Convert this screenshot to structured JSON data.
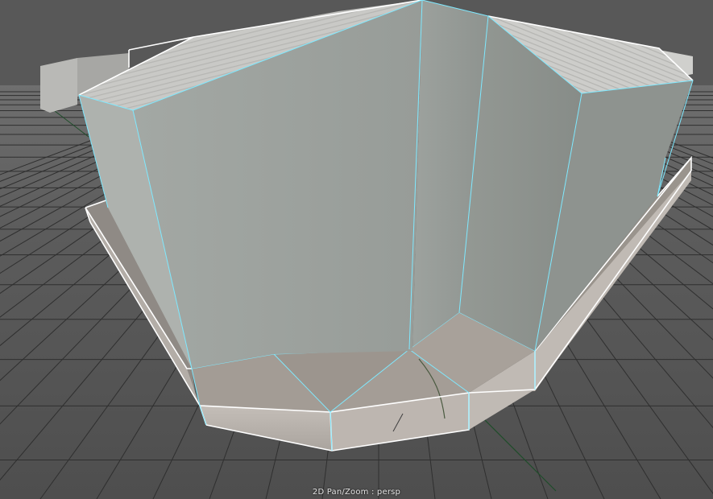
{
  "viewport": {
    "hud_label": "2D Pan/Zoom : persp"
  },
  "colors": {
    "background": "#555555",
    "grid_line": "#2f2f2f",
    "grid_fill_far": "#6b6b6b",
    "grid_fill_near": "#505050",
    "wire_selected": "#7fe9ff",
    "wire_outline": "#ffffff",
    "concrete_wall": "#9da29e",
    "concrete_wall_dark": "#8b908c",
    "roof": "#c9c9c6",
    "base_band": "#bdb7b1",
    "base_top": "#9f9890",
    "axis_line": "#1f4d2a"
  }
}
